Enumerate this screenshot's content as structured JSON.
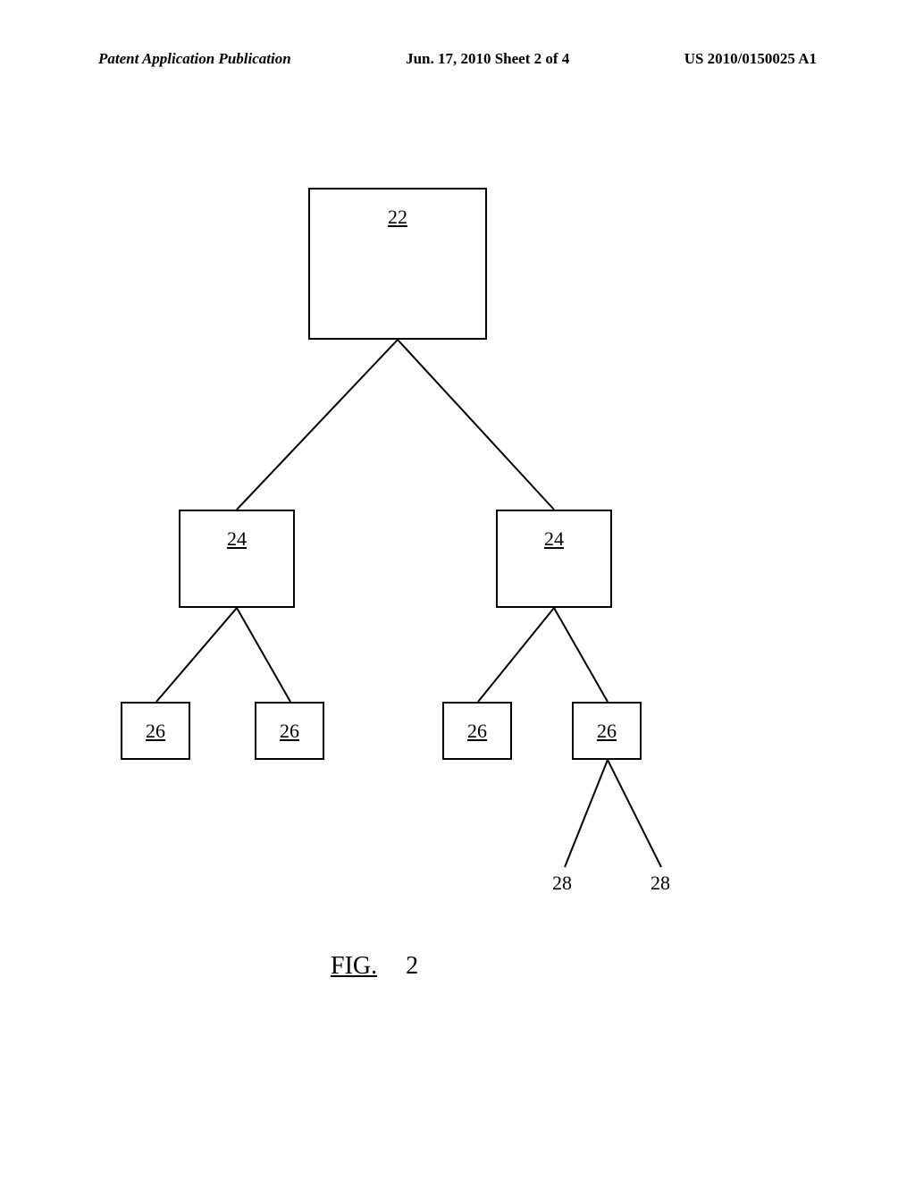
{
  "header": {
    "left": "Patent Application Publication",
    "center": "Jun. 17, 2010  Sheet 2 of 4",
    "right": "US 2010/0150025 A1"
  },
  "nodes": {
    "root": "22",
    "mid_left": "24",
    "mid_right": "24",
    "leaf_1": "26",
    "leaf_2": "26",
    "leaf_3": "26",
    "leaf_4": "26",
    "sub_1": "28",
    "sub_2": "28"
  },
  "figure": {
    "label": "FIG.",
    "number": "2"
  }
}
